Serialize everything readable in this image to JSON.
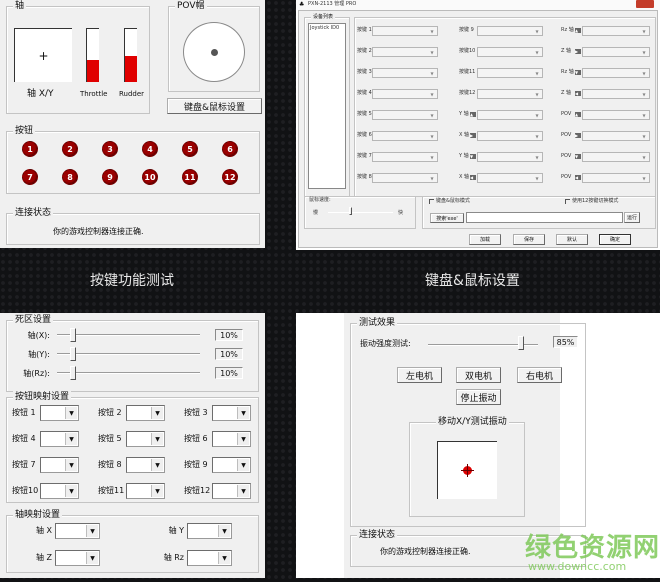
{
  "panel1": {
    "axis_group": "轴",
    "axis_xy_label": "轴 X/Y",
    "throttle_label": "Throttle",
    "rudder_label": "Rudder",
    "throttle_level": 0.42,
    "rudder_level": 0.5,
    "pov_group": "POV帽",
    "kb_mouse_button": "键盘&鼠标设置",
    "buttons_group": "按钮",
    "buttons": [
      "1",
      "2",
      "3",
      "4",
      "5",
      "6",
      "7",
      "8",
      "9",
      "10",
      "11",
      "12"
    ],
    "status_group": "连接状态",
    "status_text": "你的游戏控制器连接正确."
  },
  "panel2": {
    "title": "PXN-2113 管理 PRO",
    "device_list_group": "设备列表",
    "device_item": "Joystick ID0",
    "col1": [
      "按键 1",
      "按键 2",
      "按键 3",
      "按键 4",
      "按键 5",
      "按键 6",
      "按键 7",
      "按键 8"
    ],
    "col2": [
      "按键 9",
      "按键10",
      "按键11",
      "按键12",
      "Y 轴",
      "X 轴",
      "Y 轴",
      "X 轴"
    ],
    "col3": [
      "Rz 轴",
      "Z 轴",
      "Rz 轴",
      "Z 轴",
      "POV",
      "POV",
      "POV",
      "POV"
    ],
    "col2_arrows": [
      "",
      "",
      "",
      "",
      "up",
      "right",
      "down",
      "left"
    ],
    "col3_arrows": [
      "up",
      "right",
      "down",
      "left",
      "up",
      "right",
      "down",
      "left"
    ],
    "mouse_speed_label": "鼠标速度:",
    "slow": "慢",
    "fast": "快",
    "kb_mouse_mode": "键盘&鼠标模式",
    "use12_mode": "使用12按键切换模式",
    "browse_button": "搜索'exe'",
    "exe_path": "",
    "run_button": "运行",
    "load_button": "加载",
    "save_button": "保存",
    "default_button": "默认",
    "ok_button": "确定"
  },
  "captions": {
    "left": "按键功能测试",
    "right": "键盘&鼠标设置"
  },
  "panel3": {
    "deadzone_group": "死区设置",
    "deadzones": [
      {
        "label": "轴(X):",
        "value": "10%"
      },
      {
        "label": "轴(Y):",
        "value": "10%"
      },
      {
        "label": "轴(Rz):",
        "value": "10%"
      }
    ],
    "mapping_group": "按钮映射设置",
    "button_maps": [
      "按钮 1",
      "按钮 2",
      "按钮 3",
      "按钮 4",
      "按钮 5",
      "按钮 6",
      "按钮 7",
      "按钮 8",
      "按钮 9",
      "按钮10",
      "按钮11",
      "按钮12"
    ],
    "axis_map_group": "轴映射设置",
    "axis_maps": [
      "轴 X",
      "轴 Y",
      "轴 Z",
      "轴 Rz"
    ]
  },
  "panel4": {
    "test_group": "测试效果",
    "vib_label": "振动强度测试:",
    "vib_value": "85%",
    "vib_level": 0.85,
    "left_motor": "左电机",
    "dual_motor": "双电机",
    "right_motor": "右电机",
    "stop_vib": "停止振动",
    "xy_group": "移动X/Y测试振动",
    "status_group": "连接状态",
    "status_text": "你的游戏控制器连接正确."
  },
  "watermark": {
    "title": "绿色资源网",
    "url": "www.downcc.com",
    "color": "#7fc95a"
  }
}
